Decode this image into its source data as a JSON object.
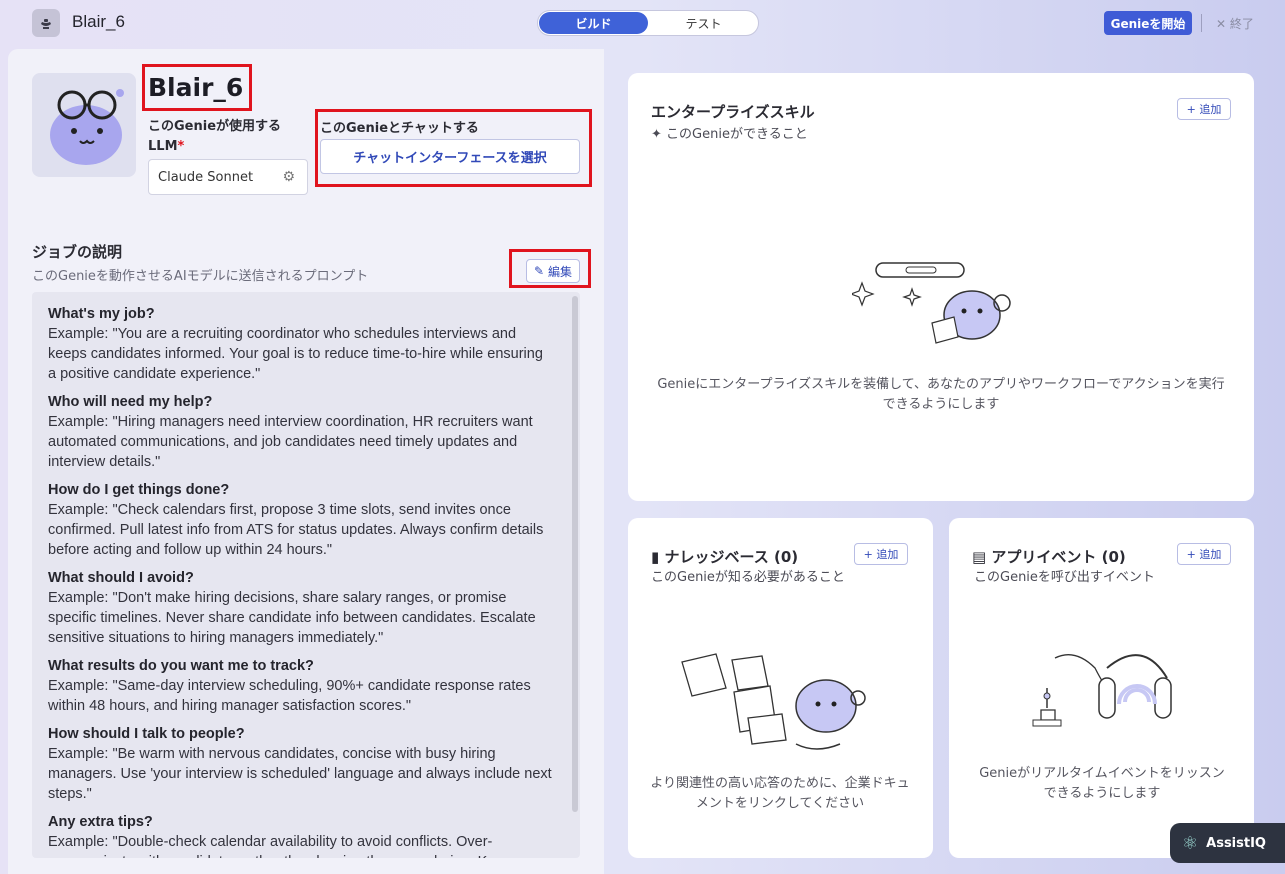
{
  "header": {
    "app_title": "Blair_6",
    "tabs": [
      "ビルド",
      "テスト"
    ],
    "active_tab": 0,
    "start_button": "Genieを開始",
    "end_button": "終了"
  },
  "profile": {
    "name": "Blair_6",
    "llm_label": "このGenieが使用するLLM",
    "llm_required_mark": "*",
    "llm_value": "Claude Sonnet",
    "chat_label": "このGenieとチャットする",
    "chat_button": "チャットインターフェースを選択"
  },
  "job": {
    "title": "ジョブの説明",
    "subtitle": "このGenieを動作させるAIモデルに送信されるプロンプト",
    "edit_button": "編集",
    "sections": [
      {
        "q": "What's my job?",
        "a": "Example: \"You are a recruiting coordinator who schedules interviews and keeps candidates informed. Your goal is to reduce time-to-hire while ensuring a positive candidate experience.\""
      },
      {
        "q": "Who will need my help?",
        "a": "Example: \"Hiring managers need interview coordination, HR recruiters want automated communications, and job candidates need timely updates and interview details.\""
      },
      {
        "q": "How do I get things done?",
        "a": "Example: \"Check calendars first, propose 3 time slots, send invites once confirmed. Pull latest info from ATS for status updates. Always confirm details before acting and follow up within 24 hours.\""
      },
      {
        "q": "What should I avoid?",
        "a": "Example: \"Don't make hiring decisions, share salary ranges, or promise specific timelines. Never share candidate info between candidates. Escalate sensitive situations to hiring managers immediately.\""
      },
      {
        "q": "What results do you want me to track?",
        "a": "Example: \"Same-day interview scheduling, 90%+ candidate response rates within 48 hours, and hiring manager satisfaction scores.\""
      },
      {
        "q": "How should I talk to people?",
        "a": "Example: \"Be warm with nervous candidates, concise with busy hiring managers. Use 'your interview is scheduled' language and always include next steps.\""
      },
      {
        "q": "Any extra tips?",
        "a": "Example: \"Double-check calendar availability to avoid conflicts. Over-communicate with candidates rather than leaving them wondering. Keep..."
      }
    ]
  },
  "skills": {
    "title": "エンタープライズスキル",
    "subtitle": "このGenieができること",
    "add_button": "+ 追加",
    "description": "Genieにエンタープライズスキルを装備して、あなたのアプリやワークフローでアクションを実行できるようにします"
  },
  "knowledge": {
    "title": "ナレッジベース (0)",
    "subtitle": "このGenieが知る必要があること",
    "add_button": "+ 追加",
    "description": "より関連性の高い応答のために、企業ドキュメントをリンクしてください"
  },
  "events": {
    "title": "アプリイベント (0)",
    "subtitle": "このGenieを呼び出すイベント",
    "add_button": "+ 追加",
    "description": "Genieがリアルタイムイベントをリッスンできるようにします"
  },
  "badge": {
    "label": "AssistIQ"
  },
  "colors": {
    "accent": "#3f5bd6",
    "highlight": "#e0141e"
  }
}
